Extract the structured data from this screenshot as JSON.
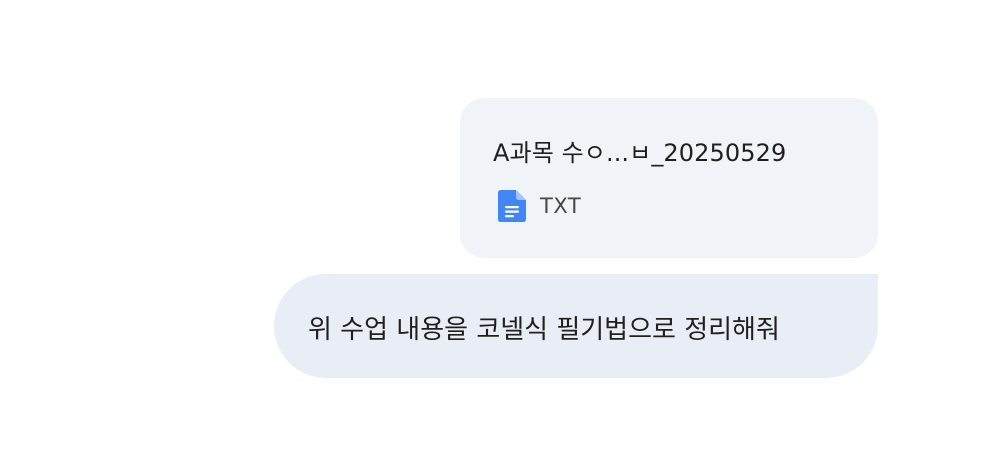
{
  "attachment": {
    "file_name": "A과목 수ㅇ...ㅂ_20250529",
    "file_type": "TXT",
    "icon": "google-docs-icon",
    "icon_color": "#4285f4"
  },
  "message": {
    "text": "위 수업 내용을 코넬식 필기법으로 정리해줘"
  },
  "colors": {
    "attachment_bg": "#f0f4f9",
    "message_bg": "#e9eef6",
    "text": "#1f1f1f",
    "secondary_text": "#444746"
  }
}
